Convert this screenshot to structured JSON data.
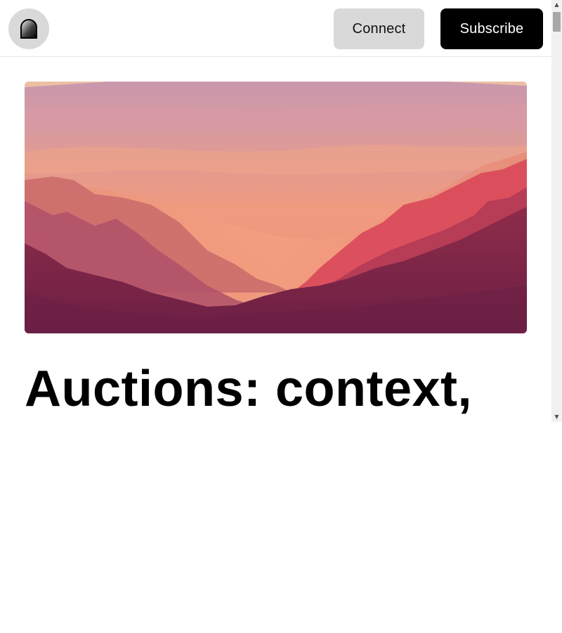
{
  "header": {
    "logo_icon": "arch-logo-icon",
    "connect_label": "Connect",
    "subscribe_label": "Subscribe"
  },
  "hero": {
    "image": "pink-mountain-valley-landscape"
  },
  "article": {
    "title": "Auctions: context,"
  },
  "colors": {
    "subscribe_bg": "#000000",
    "connect_bg": "#d9d9d9",
    "hero_sky": "#f4a07a",
    "hero_mountains": "#8a2a4a"
  },
  "scrollbar": {
    "up_icon": "▲",
    "down_icon": "▼"
  }
}
